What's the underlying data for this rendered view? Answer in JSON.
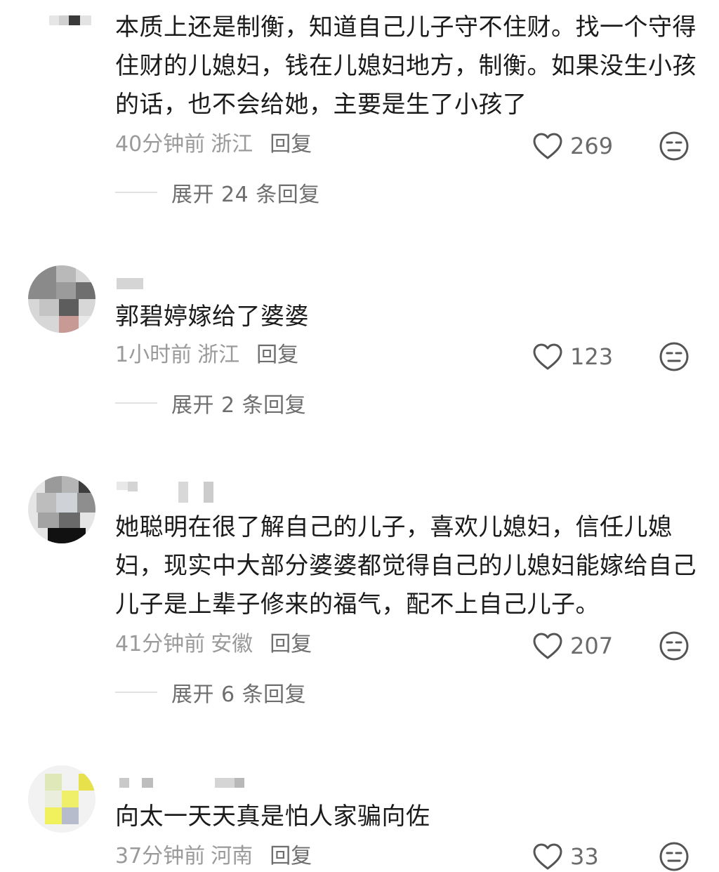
{
  "comments": [
    {
      "text": "本质上还是制衡，知道自己儿子守不住财。找一个守得住财的儿媳妇，钱在儿媳妇地方，制衡。如果没生小孩的话，也不会给她，主要是生了小孩了",
      "time": "40分钟前",
      "location": "浙江",
      "reply": "回复",
      "likes": "269",
      "expand": "展开 24 条回复"
    },
    {
      "text": "郭碧婷嫁给了婆婆",
      "time": "1小时前",
      "location": "浙江",
      "reply": "回复",
      "likes": "123",
      "expand": "展开 2 条回复"
    },
    {
      "text": "她聪明在很了解自己的儿子，喜欢儿媳妇，信任儿媳妇，现实中大部分婆婆都觉得自己的儿媳妇能嫁给自己儿子是上辈子修来的福气，配不上自己儿子。",
      "time": "41分钟前",
      "location": "安徽",
      "reply": "回复",
      "likes": "207",
      "expand": "展开 6 条回复"
    },
    {
      "text": "向太一天天真是怕人家骗向佐",
      "time": "37分钟前",
      "location": "河南",
      "reply": "回复",
      "likes": "33",
      "expand": ""
    }
  ],
  "icons": {
    "like": "heart-outline-icon",
    "dislike": "expressionless-face-icon"
  },
  "colors": {
    "text": "#1b1b1b",
    "meta": "#9a9a9a",
    "reply": "#6e6e6e",
    "icon": "#555555"
  }
}
